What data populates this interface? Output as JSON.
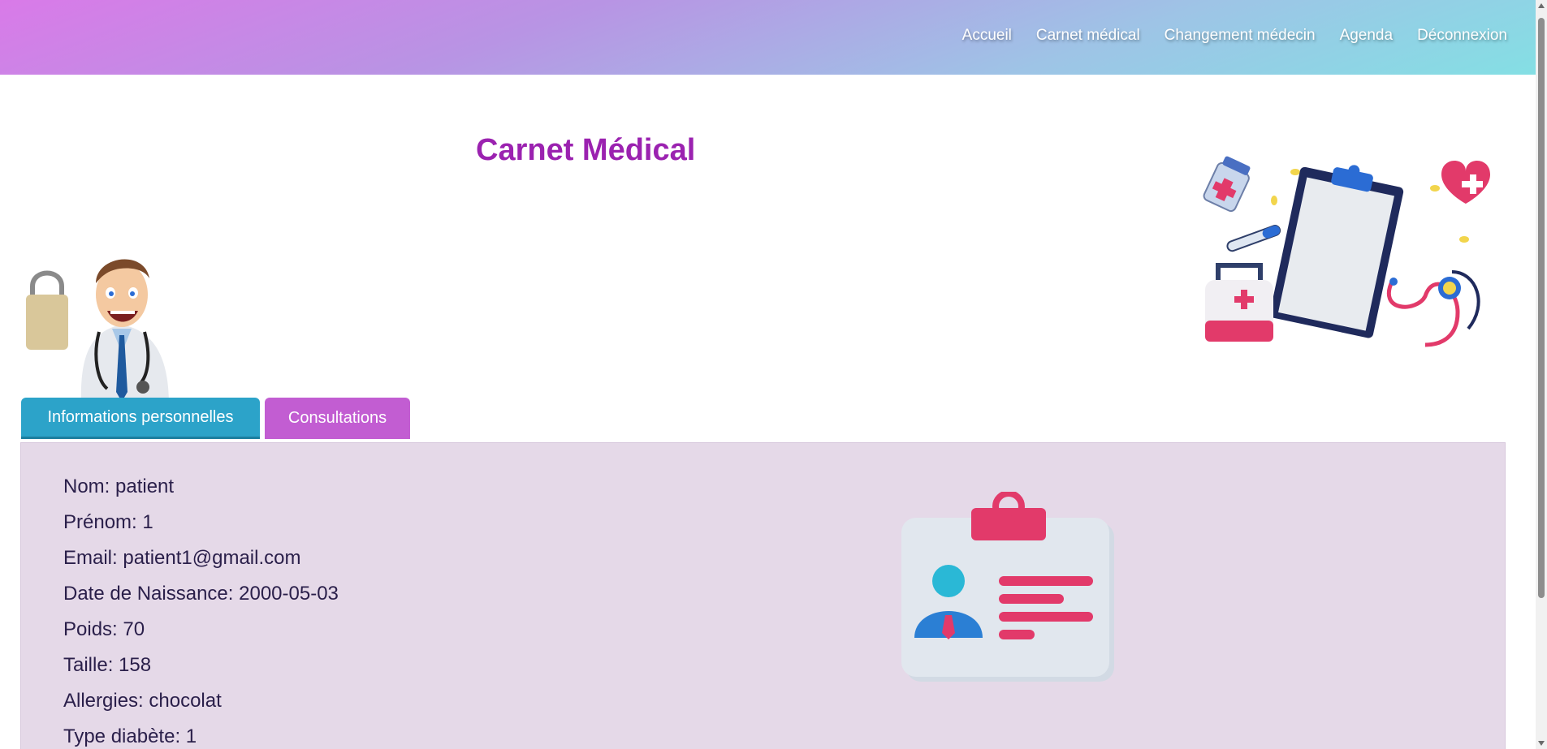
{
  "nav": {
    "items": [
      {
        "label": "Accueil"
      },
      {
        "label": "Carnet médical"
      },
      {
        "label": "Changement médecin"
      },
      {
        "label": "Agenda"
      },
      {
        "label": "Déconnexion"
      }
    ]
  },
  "page": {
    "title": "Carnet Médical"
  },
  "tabs": {
    "info_label": "Informations personnelles",
    "consult_label": "Consultations"
  },
  "patient": {
    "nom": "Nom: patient",
    "prenom": "Prénom: 1",
    "email": "Email: patient1@gmail.com",
    "naissance": "Date de Naissance: 2000-05-03",
    "poids": "Poids: 70",
    "taille": "Taille: 158",
    "allergies": "Allergies: chocolat",
    "diabete": "Type diabète: 1"
  },
  "colors": {
    "title": "#9b22b0",
    "tab_active": "#2ca3c9",
    "tab_inactive": "#c25dd2",
    "panel_bg": "#e5d9e8"
  },
  "icons": {
    "doctor": "doctor-illustration",
    "medical": "medical-items-illustration",
    "id_card": "id-card-icon"
  }
}
